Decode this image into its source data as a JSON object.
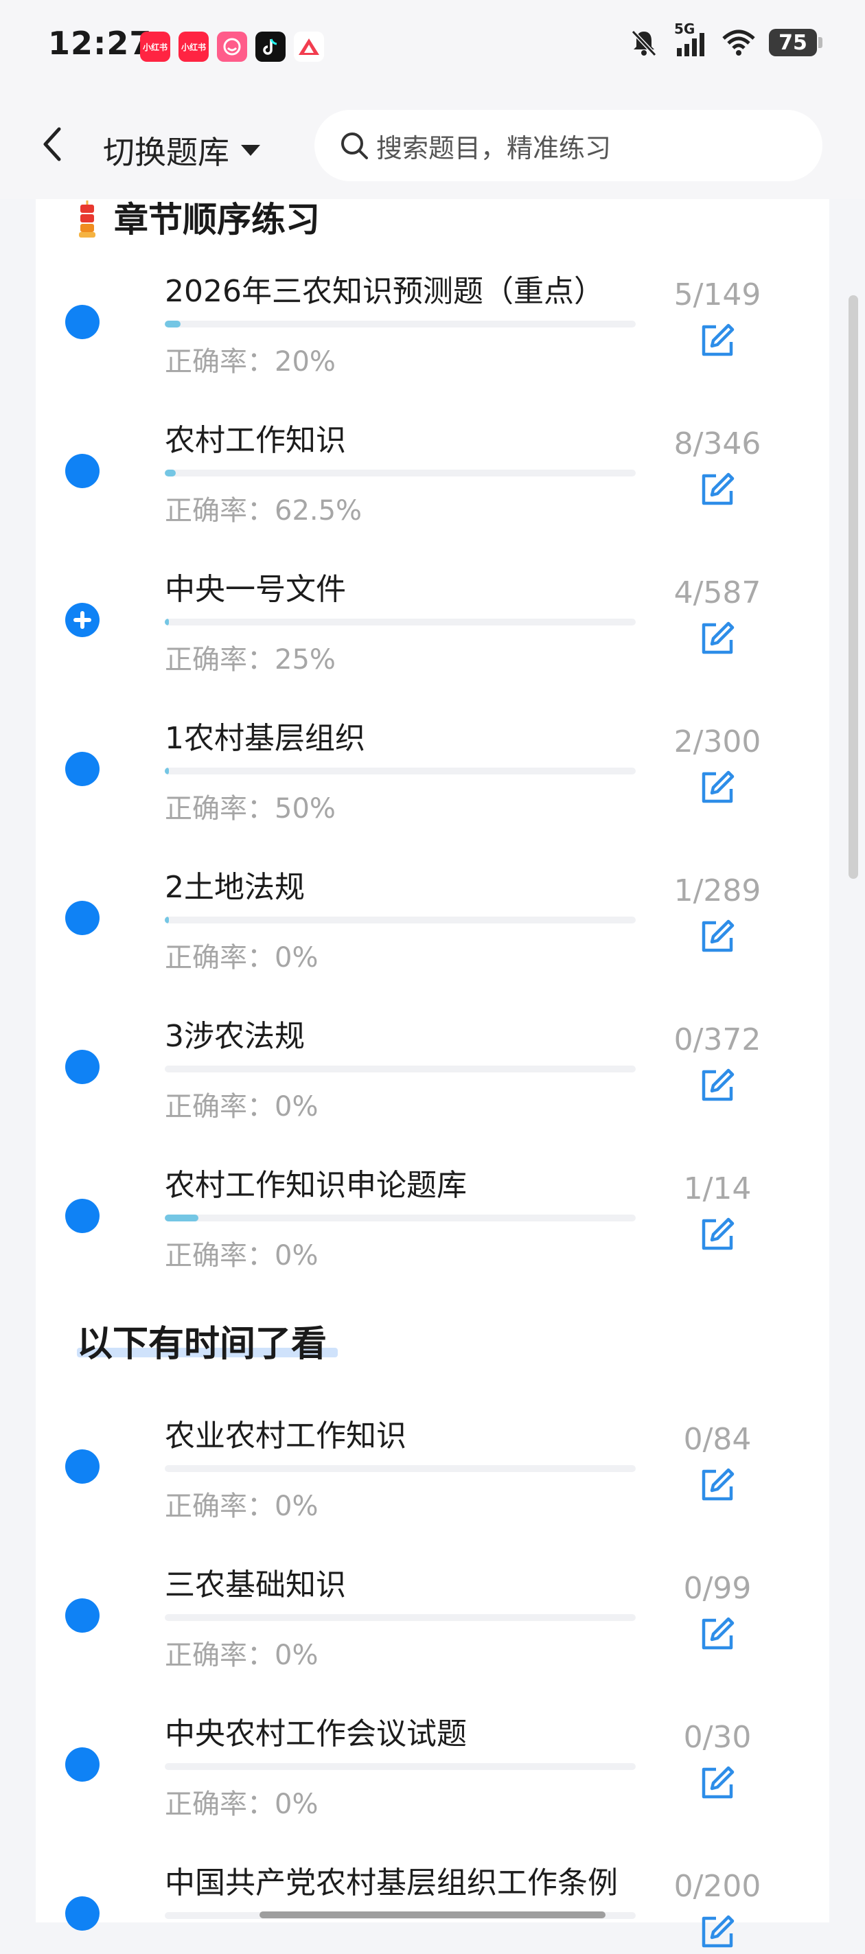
{
  "status_bar": {
    "time": "12:27",
    "network": "5G",
    "battery": "75",
    "app_icons": [
      {
        "label": "小红书",
        "color": "#ff2442"
      },
      {
        "label": "小红书",
        "color": "#ff2442"
      },
      {
        "label": "",
        "color": "#ff5c8a"
      },
      {
        "label": "",
        "color": "#111111"
      },
      {
        "label": "",
        "color": "#ffffff"
      }
    ]
  },
  "header": {
    "switch_label": "切换题库",
    "search_placeholder": "搜索题目，精准练习"
  },
  "sections": [
    {
      "title": "章节顺序练习"
    },
    {
      "title": "以下有时间了看"
    }
  ],
  "accuracy_prefix": "正确率：",
  "items": [
    {
      "title": "2026年三农知识预测题（重点）",
      "accuracy": "正确率：20%",
      "count": "5/149",
      "progress": 0.034,
      "dot": "filled"
    },
    {
      "title": "农村工作知识",
      "accuracy": "正确率：62.5%",
      "count": "8/346",
      "progress": 0.023,
      "dot": "filled"
    },
    {
      "title": "中央一号文件",
      "accuracy": "正确率：25%",
      "count": "4/587",
      "progress": 0.007,
      "dot": "plus"
    },
    {
      "title": "1农村基层组织",
      "accuracy": "正确率：50%",
      "count": "2/300",
      "progress": 0.007,
      "dot": "filled"
    },
    {
      "title": "2土地法规",
      "accuracy": "正确率：0%",
      "count": "1/289",
      "progress": 0.0035,
      "dot": "filled"
    },
    {
      "title": "3涉农法规",
      "accuracy": "正确率：0%",
      "count": "0/372",
      "progress": 0.0,
      "dot": "filled"
    },
    {
      "title": "农村工作知识申论题库",
      "accuracy": "正确率：0%",
      "count": "1/14",
      "progress": 0.071,
      "dot": "filled"
    },
    {
      "title": "农业农村工作知识",
      "accuracy": "正确率：0%",
      "count": "0/84",
      "progress": 0.0,
      "dot": "filled"
    },
    {
      "title": "三农基础知识",
      "accuracy": "正确率：0%",
      "count": "0/99",
      "progress": 0.0,
      "dot": "filled"
    },
    {
      "title": "中央农村工作会议试题",
      "accuracy": "正确率：0%",
      "count": "0/30",
      "progress": 0.0,
      "dot": "filled"
    },
    {
      "title": "中国共产党农村基层组织工作条例",
      "accuracy": "",
      "count": "0/200",
      "progress": 0.0,
      "dot": "filled"
    }
  ],
  "colors": {
    "accent": "#0f82f5",
    "progress": "#74c6e4",
    "muted_text": "#a6a6a6"
  }
}
